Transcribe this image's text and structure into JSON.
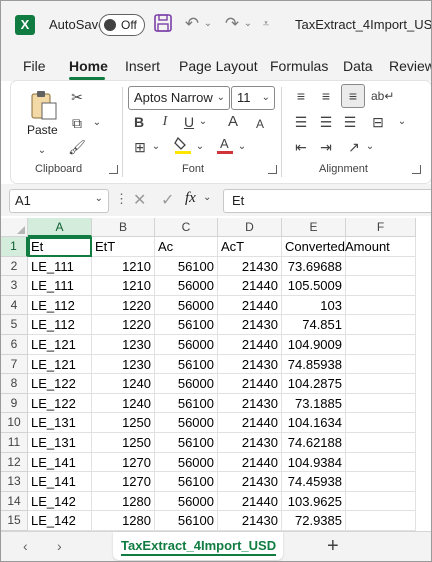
{
  "titlebar": {
    "app_icon": "X",
    "autosave_label": "AutoSave",
    "toggle_state": "Off",
    "doc_title": "TaxExtract_4Import_USD •"
  },
  "tabs": [
    "File",
    "Home",
    "Insert",
    "Page Layout",
    "Formulas",
    "Data",
    "Review"
  ],
  "active_tab": "Home",
  "ribbon": {
    "clipboard": {
      "paste_label": "Paste",
      "group_label": "Clipboard"
    },
    "font": {
      "font_name": "Aptos Narrow",
      "font_size": "11",
      "group_label": "Font",
      "bold": "B",
      "italic": "I",
      "underline": "U",
      "grow": "A",
      "shrink": "A"
    },
    "alignment": {
      "group_label": "Alignment"
    }
  },
  "formula_bar": {
    "name_box": "A1",
    "fx": "fx",
    "value": "Et"
  },
  "columns": [
    "A",
    "B",
    "C",
    "D",
    "E",
    "F"
  ],
  "rows": [
    {
      "n": "1",
      "cells": [
        "Et",
        "EtT",
        "Ac",
        "AcT",
        "ConvertedAmount",
        ""
      ]
    },
    {
      "n": "2",
      "cells": [
        "LE_111",
        "1210",
        "56100",
        "21430",
        "73.69688",
        ""
      ]
    },
    {
      "n": "3",
      "cells": [
        "LE_111",
        "1210",
        "56000",
        "21440",
        "105.5009",
        ""
      ]
    },
    {
      "n": "4",
      "cells": [
        "LE_112",
        "1220",
        "56000",
        "21440",
        "103",
        ""
      ]
    },
    {
      "n": "5",
      "cells": [
        "LE_112",
        "1220",
        "56100",
        "21430",
        "74.851",
        ""
      ]
    },
    {
      "n": "6",
      "cells": [
        "LE_121",
        "1230",
        "56000",
        "21440",
        "104.9009",
        ""
      ]
    },
    {
      "n": "7",
      "cells": [
        "LE_121",
        "1230",
        "56100",
        "21430",
        "74.85938",
        ""
      ]
    },
    {
      "n": "8",
      "cells": [
        "LE_122",
        "1240",
        "56000",
        "21440",
        "104.2875",
        ""
      ]
    },
    {
      "n": "9",
      "cells": [
        "LE_122",
        "1240",
        "56100",
        "21430",
        "73.1885",
        ""
      ]
    },
    {
      "n": "10",
      "cells": [
        "LE_131",
        "1250",
        "56000",
        "21440",
        "104.1634",
        ""
      ]
    },
    {
      "n": "11",
      "cells": [
        "LE_131",
        "1250",
        "56100",
        "21430",
        "74.62188",
        ""
      ]
    },
    {
      "n": "12",
      "cells": [
        "LE_141",
        "1270",
        "56000",
        "21440",
        "104.9384",
        ""
      ]
    },
    {
      "n": "13",
      "cells": [
        "LE_141",
        "1270",
        "56100",
        "21430",
        "74.45938",
        ""
      ]
    },
    {
      "n": "14",
      "cells": [
        "LE_142",
        "1280",
        "56000",
        "21440",
        "103.9625",
        ""
      ]
    },
    {
      "n": "15",
      "cells": [
        "LE_142",
        "1280",
        "56100",
        "21430",
        "72.9385",
        ""
      ]
    }
  ],
  "sheet_tab": "TaxExtract_4Import_USD",
  "colors": {
    "accent": "#107c41",
    "font_color_bar": "#d13438",
    "highlight_bar": "#ffe600"
  }
}
